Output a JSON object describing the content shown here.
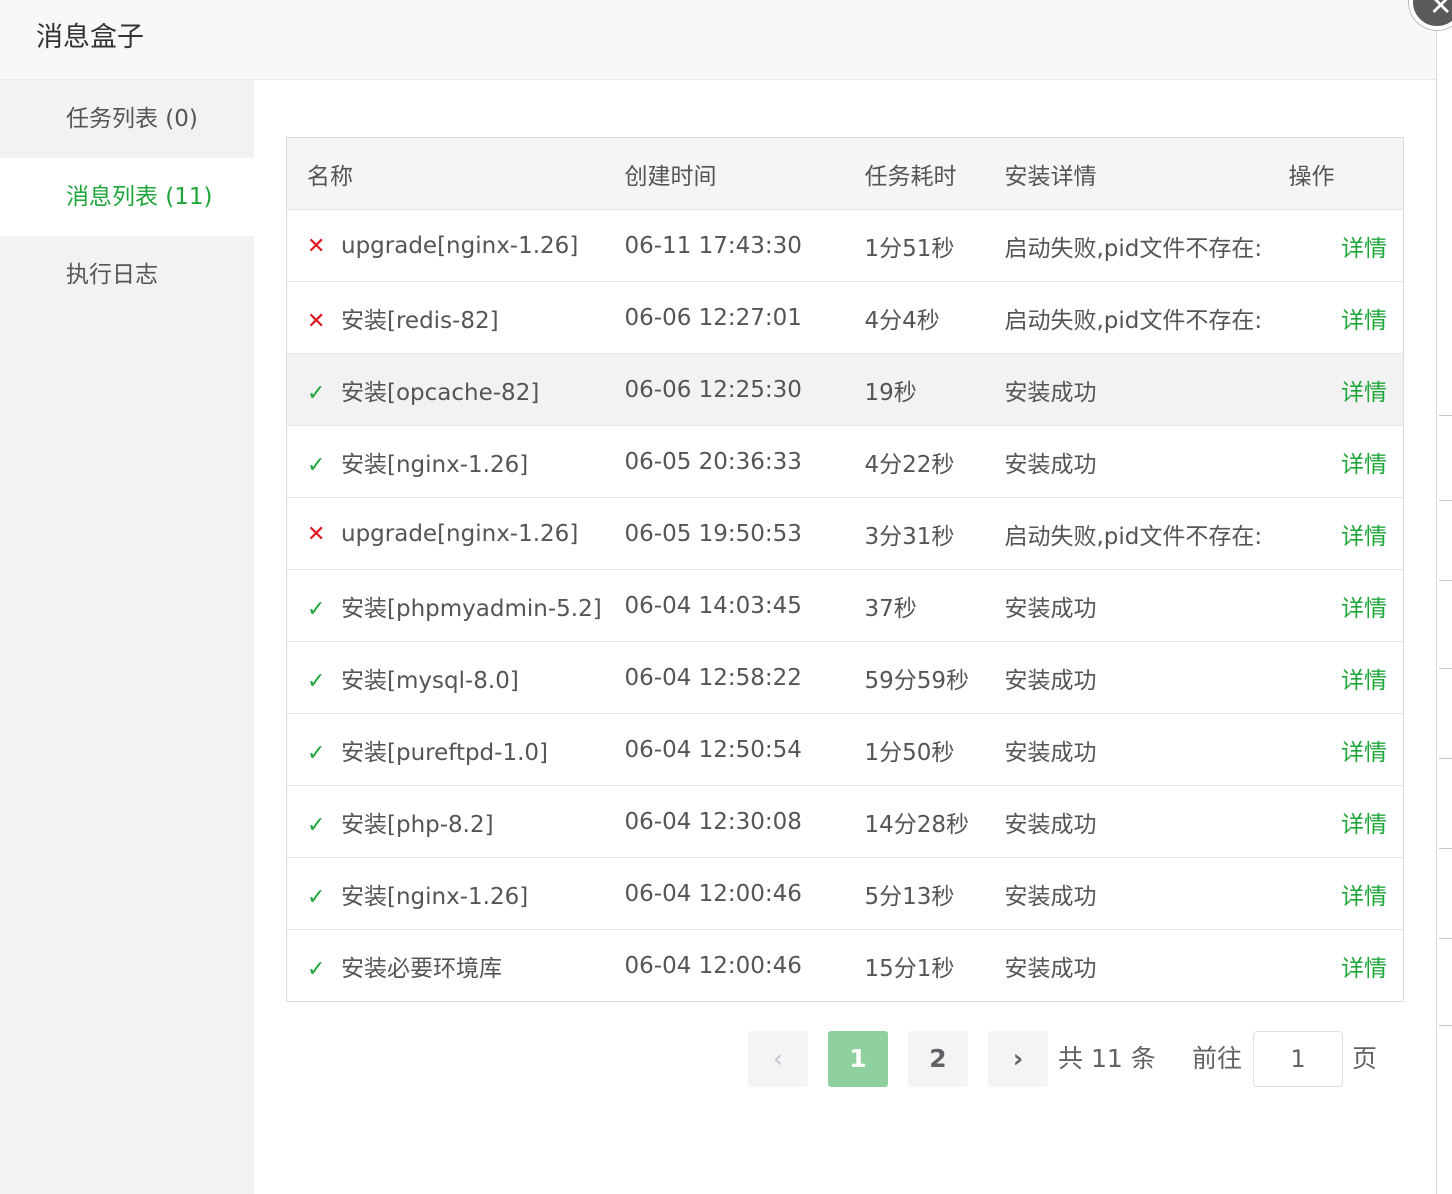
{
  "dialog": {
    "title": "消息盒子",
    "close_glyph": "✕"
  },
  "sidebar": {
    "items": [
      {
        "label": "任务列表 (0)",
        "active": false
      },
      {
        "label": "消息列表 (11)",
        "active": true
      },
      {
        "label": "执行日志",
        "active": false
      }
    ]
  },
  "table": {
    "headers": {
      "name": "名称",
      "created": "创建时间",
      "duration": "任务耗时",
      "details": "安装详情",
      "action": "操作"
    },
    "rows": [
      {
        "status": "fail",
        "mark": "✕",
        "name": "upgrade[nginx-1.26]",
        "created": "06-11 17:43:30",
        "duration": "1分51秒",
        "details": "启动失败,pid文件不存在:",
        "action": "详情"
      },
      {
        "status": "fail",
        "mark": "✕",
        "name": "安装[redis-82]",
        "created": "06-06 12:27:01",
        "duration": "4分4秒",
        "details": "启动失败,pid文件不存在:",
        "action": "详情"
      },
      {
        "status": "ok",
        "mark": "✓",
        "name": "安装[opcache-82]",
        "created": "06-06 12:25:30",
        "duration": "19秒",
        "details": "安装成功",
        "action": "详情"
      },
      {
        "status": "ok",
        "mark": "✓",
        "name": "安装[nginx-1.26]",
        "created": "06-05 20:36:33",
        "duration": "4分22秒",
        "details": "安装成功",
        "action": "详情"
      },
      {
        "status": "fail",
        "mark": "✕",
        "name": "upgrade[nginx-1.26]",
        "created": "06-05 19:50:53",
        "duration": "3分31秒",
        "details": "启动失败,pid文件不存在:",
        "action": "详情"
      },
      {
        "status": "ok",
        "mark": "✓",
        "name": "安装[phpmyadmin-5.2]",
        "created": "06-04 14:03:45",
        "duration": "37秒",
        "details": "安装成功",
        "action": "详情"
      },
      {
        "status": "ok",
        "mark": "✓",
        "name": "安装[mysql-8.0]",
        "created": "06-04 12:58:22",
        "duration": "59分59秒",
        "details": "安装成功",
        "action": "详情"
      },
      {
        "status": "ok",
        "mark": "✓",
        "name": "安装[pureftpd-1.0]",
        "created": "06-04 12:50:54",
        "duration": "1分50秒",
        "details": "安装成功",
        "action": "详情"
      },
      {
        "status": "ok",
        "mark": "✓",
        "name": "安装[php-8.2]",
        "created": "06-04 12:30:08",
        "duration": "14分28秒",
        "details": "安装成功",
        "action": "详情"
      },
      {
        "status": "ok",
        "mark": "✓",
        "name": "安装[nginx-1.26]",
        "created": "06-04 12:00:46",
        "duration": "5分13秒",
        "details": "安装成功",
        "action": "详情"
      },
      {
        "status": "ok",
        "mark": "✓",
        "name": "安装必要环境库",
        "created": "06-04 12:00:46",
        "duration": "15分1秒",
        "details": "安装成功",
        "action": "详情"
      }
    ]
  },
  "pagination": {
    "prev_glyph": "‹",
    "next_glyph": "›",
    "pages": [
      "1",
      "2"
    ],
    "current_page": "1",
    "total_text": "共 11 条",
    "goto_label": "前往",
    "goto_value": "1",
    "page_suffix": "页"
  },
  "colors": {
    "accent_green": "#20a53a",
    "error_red": "#e0141e",
    "current_page_bg": "#8fd19e"
  }
}
